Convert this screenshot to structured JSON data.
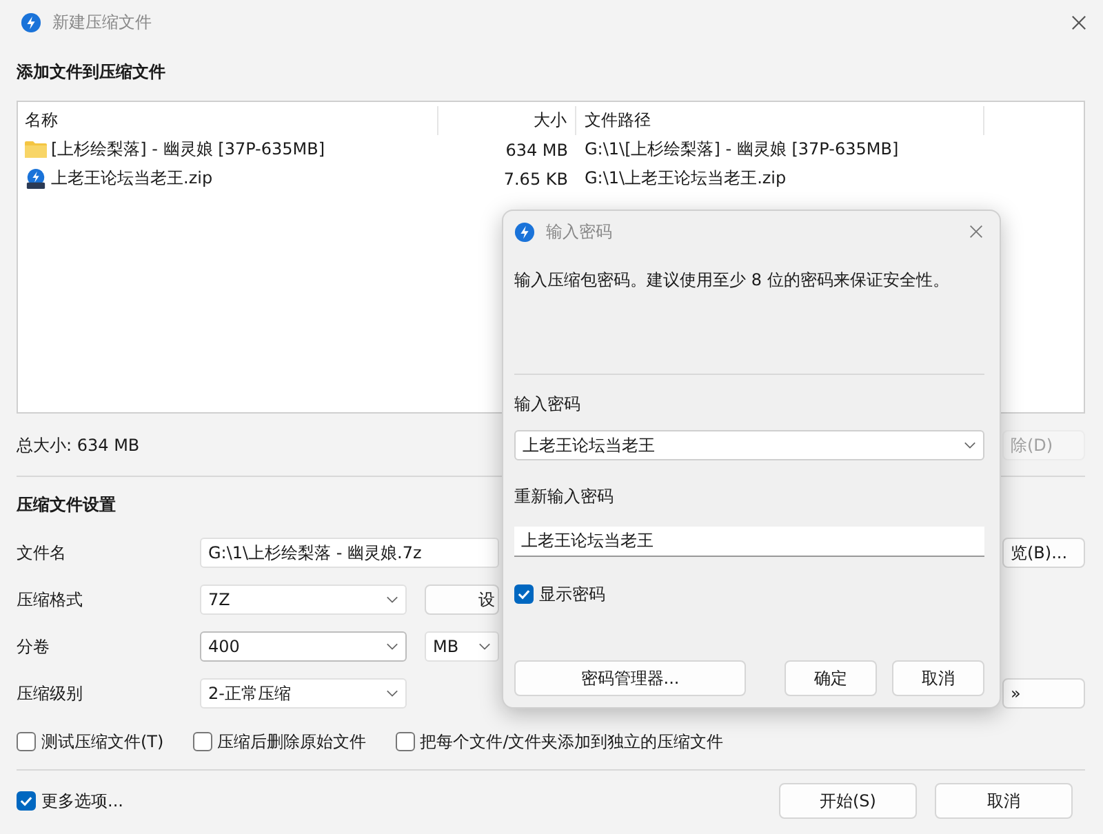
{
  "window": {
    "title": "新建压缩文件"
  },
  "files": {
    "heading": "添加文件到压缩文件",
    "columns": [
      "名称",
      "大小",
      "文件路径"
    ],
    "rows": [
      {
        "kind": "folder",
        "name": "[上杉绘梨落] - 幽灵娘 [37P-635MB]",
        "size": "634 MB",
        "path": "G:\\1\\[上杉绘梨落] - 幽灵娘 [37P-635MB]"
      },
      {
        "kind": "archive",
        "name": "上老王论坛当老王.zip",
        "size": "7.65 KB",
        "path": "G:\\1\\上老王论坛当老王.zip"
      }
    ]
  },
  "total_size": "总大小: 634 MB",
  "delete_button": "除(D)",
  "settings": {
    "heading": "压缩文件设置",
    "fields": [
      {
        "kind": "text",
        "label": "文件名",
        "value": "G:\\1\\上杉绘梨落 - 幽灵娘.7z",
        "side_button": "览(B)..."
      },
      {
        "kind": "select",
        "label": "压缩格式",
        "value": "7Z",
        "button": "设"
      },
      {
        "kind": "combo",
        "label": "分卷",
        "value": "400",
        "unit": "MB"
      },
      {
        "kind": "select",
        "label": "压缩级别",
        "value": "2-正常压缩",
        "side_button": "»"
      }
    ]
  },
  "options": [
    {
      "label": "测试压缩文件(T)",
      "checked": false
    },
    {
      "label": "压缩后删除原始文件",
      "checked": false
    },
    {
      "label": "把每个文件/文件夹添加到独立的压缩文件",
      "checked": false
    }
  ],
  "more_options": {
    "label": "更多选项...",
    "checked": true
  },
  "buttons": [
    "开始(S)",
    "取消"
  ],
  "dialog": {
    "title": "输入密码",
    "description": "输入压缩包密码。建议使用至少 8 位的密码来保证安全性。",
    "password_label": "输入密码",
    "password": "上老王论坛当老王",
    "confirm_label": "重新输入密码",
    "confirm": "上老王论坛当老王",
    "show_password": {
      "label": "显示密码",
      "checked": true
    },
    "buttons": [
      "密码管理器...",
      "确定",
      "取消"
    ]
  }
}
